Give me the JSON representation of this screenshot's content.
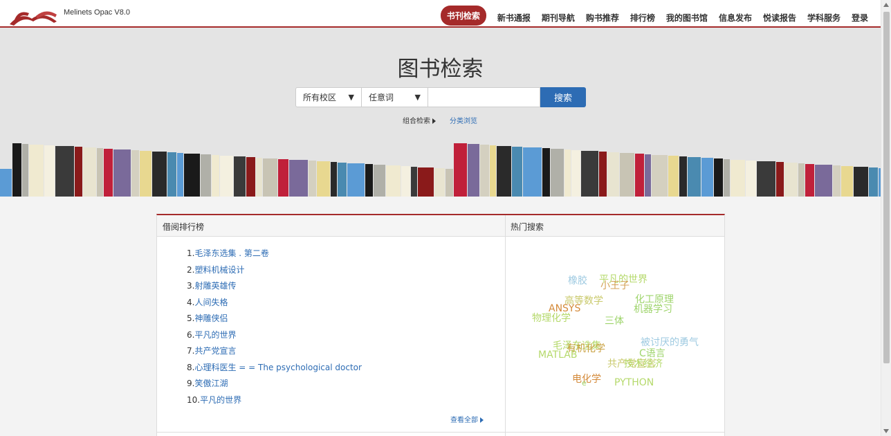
{
  "header": {
    "app_title": "Melinets Opac V8.0",
    "nav": [
      "书刊检索",
      "新书通报",
      "期刊导航",
      "购书推荐",
      "排行榜",
      "我的图书馆",
      "信息发布",
      "悦读报告",
      "学科服务",
      "登录"
    ],
    "brand_color": "#a52a2a"
  },
  "search": {
    "title": "图书检索",
    "campus": "所有校区",
    "field": "任意词",
    "query": "",
    "button": "搜索",
    "advanced": "组合检索",
    "browse": "分类浏览"
  },
  "ranking": {
    "title": "借阅排行榜",
    "items": [
      "1.",
      "2.",
      "3.",
      "4.",
      "5.",
      "6.",
      "7.",
      "8.",
      "9.",
      "10."
    ],
    "titles": [
      "毛泽东选集 . 第二卷",
      "塑料机械设计",
      "射雕英雄传",
      "人间失格",
      "神雕侠侣",
      "平凡的世界",
      "共产党宣言",
      "心理科医生 = = The psychological doctor",
      "笑傲江湖",
      "平凡的世界"
    ],
    "view_all": "查看全部"
  },
  "hot": {
    "title": "热门搜索",
    "tags": [
      "橡胶",
      "平凡的世界",
      "小王子",
      "高等数学",
      "化工原理",
      "ANSYS",
      "机器学习",
      "物理化学",
      "三体",
      "被讨厌的勇气",
      "毛泽东选集",
      "有机化学",
      "C语言",
      "MATLAB",
      "共产党宣言",
      "技术经济",
      "电化学",
      "e",
      "PYTHON"
    ],
    "colors": [
      "#9ecae1",
      "#b5d96b",
      "#d4a055",
      "#c9c96b",
      "#9ed46b",
      "#d48a3a",
      "#9ed46b",
      "#b5d96b",
      "#9ed46b",
      "#9ecae1",
      "#b5d96b",
      "#c9a040",
      "#9ed46b",
      "#b5d96b",
      "#c9c96b",
      "#b5d96b",
      "#d48a3a",
      "#9ed46b",
      "#b5d96b"
    ]
  }
}
